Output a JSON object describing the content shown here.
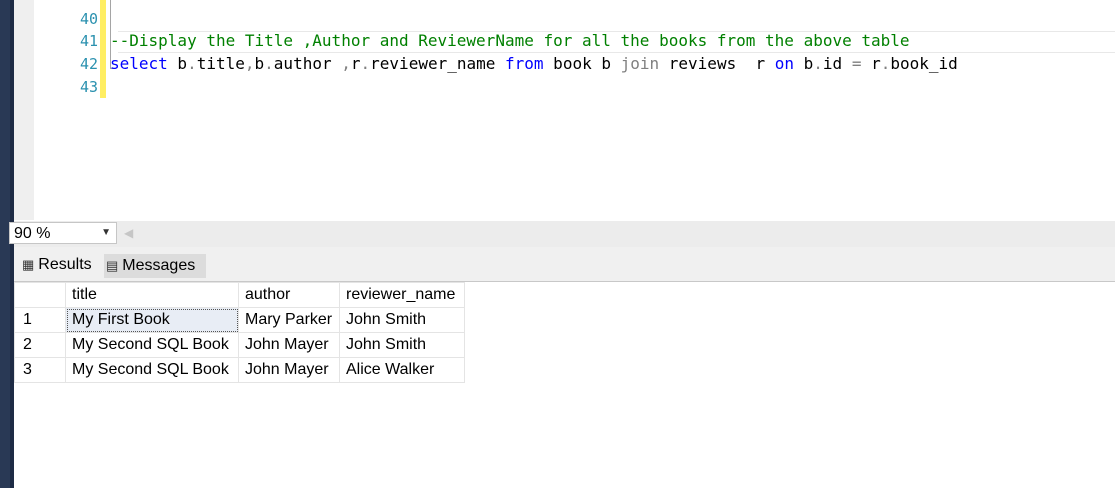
{
  "editor": {
    "line_numbers": [
      "40",
      "41",
      "42",
      "43"
    ],
    "comment_line": "--Display the Title ,Author and ReviewerName for all the books from the above table",
    "query_tokens": [
      {
        "t": "select",
        "c": "kw"
      },
      {
        "t": " b",
        "c": "plain"
      },
      {
        "t": ".",
        "c": "gray"
      },
      {
        "t": "title",
        "c": "plain"
      },
      {
        "t": ",",
        "c": "gray"
      },
      {
        "t": "b",
        "c": "plain"
      },
      {
        "t": ".",
        "c": "gray"
      },
      {
        "t": "author ",
        "c": "plain"
      },
      {
        "t": ",",
        "c": "gray"
      },
      {
        "t": "r",
        "c": "plain"
      },
      {
        "t": ".",
        "c": "gray"
      },
      {
        "t": "reviewer_name ",
        "c": "plain"
      },
      {
        "t": "from",
        "c": "kw"
      },
      {
        "t": " book b ",
        "c": "plain"
      },
      {
        "t": "join",
        "c": "gray"
      },
      {
        "t": " reviews  r ",
        "c": "plain"
      },
      {
        "t": "on",
        "c": "kw"
      },
      {
        "t": " b",
        "c": "plain"
      },
      {
        "t": ".",
        "c": "gray"
      },
      {
        "t": "id ",
        "c": "plain"
      },
      {
        "t": "=",
        "c": "gray"
      },
      {
        "t": " r",
        "c": "plain"
      },
      {
        "t": ".",
        "c": "gray"
      },
      {
        "t": "book_id",
        "c": "plain"
      }
    ]
  },
  "zoom": {
    "value": "90 %"
  },
  "tabs": {
    "results": "Results",
    "messages": "Messages"
  },
  "grid": {
    "columns": [
      "title",
      "author",
      "reviewer_name"
    ],
    "rows": [
      {
        "num": "1",
        "title": "My First Book",
        "author": "Mary Parker",
        "reviewer_name": "John Smith"
      },
      {
        "num": "2",
        "title": "My Second SQL Book",
        "author": "John Mayer",
        "reviewer_name": "John Smith"
      },
      {
        "num": "3",
        "title": "My Second SQL Book",
        "author": "John Mayer",
        "reviewer_name": "Alice Walker"
      }
    ]
  }
}
